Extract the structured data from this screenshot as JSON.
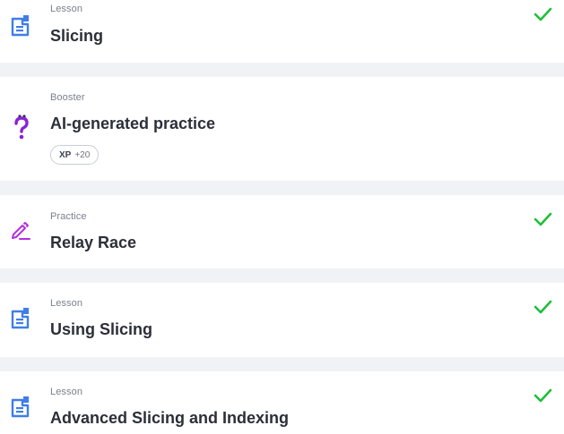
{
  "items": [
    {
      "kind": "Lesson",
      "title": "Slicing",
      "icon": "lesson-document-icon",
      "completed": true
    },
    {
      "kind": "Booster",
      "title": "AI-generated practice",
      "icon": "question-mark-icon",
      "completed": false,
      "xp_label": "XP",
      "xp_value": "+20"
    },
    {
      "kind": "Practice",
      "title": "Relay Race",
      "icon": "pencil-icon",
      "completed": true
    },
    {
      "kind": "Lesson",
      "title": "Using Slicing",
      "icon": "lesson-document-icon",
      "completed": true
    },
    {
      "kind": "Lesson",
      "title": "Advanced Slicing and Indexing",
      "icon": "lesson-document-icon",
      "completed": true
    }
  ],
  "colors": {
    "lesson_icon": "#3f7ee8",
    "booster_icon": "#8a22d6",
    "practice_icon": "#b42ee0",
    "check": "#1fbf3a",
    "background": "#f0f2f6"
  }
}
